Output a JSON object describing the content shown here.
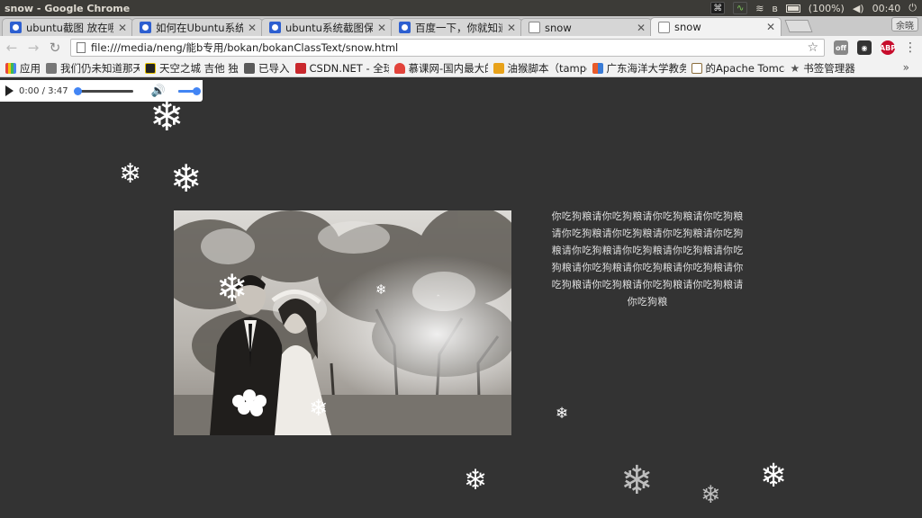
{
  "os": {
    "window_title": "snow - Google Chrome",
    "battery": "(100%)",
    "clock": "00:40"
  },
  "tabs": [
    {
      "label": "ubuntu截图 放在哪",
      "icon": "baidu-paw-icon"
    },
    {
      "label": "如何在Ubuntu系统",
      "icon": "baidu-paw-icon"
    },
    {
      "label": "ubuntu系统截图保",
      "icon": "baidu-paw-icon"
    },
    {
      "label": "百度一下，你就知道",
      "icon": "baidu-paw-icon"
    },
    {
      "label": "snow",
      "icon": "page-icon"
    },
    {
      "label": "snow",
      "icon": "page-icon",
      "active": true
    }
  ],
  "profile_label": "余晓",
  "toolbar": {
    "url": "file:///media/neng/能b专用/bokan/bokanClassText/snow.html"
  },
  "bookmarks": [
    {
      "label": "应用",
      "color": "#e8453c"
    },
    {
      "label": "我们仍未知道那天",
      "color": "#555555"
    },
    {
      "label": "天空之城 吉他 独奏",
      "color": "#222222"
    },
    {
      "label": "已导入",
      "color": "#5a5a5a"
    },
    {
      "label": "CSDN.NET - 全球",
      "color": "#c9282d"
    },
    {
      "label": "慕课网-国内最大的",
      "color": "#e2433b"
    },
    {
      "label": "油猴脚本（tampe",
      "color": "#e8a21a"
    },
    {
      "label": "广东海洋大学教务",
      "color": "#e95b2a"
    },
    {
      "label": "的Apache Tomcat",
      "color": "#8a6d3b"
    },
    {
      "label": "书签管理器",
      "color": "#555555"
    }
  ],
  "audio": {
    "time": "0:00 / 3:47",
    "progress": 0,
    "volume": 1
  },
  "poem": "你吃狗粮请你吃狗粮请你吃狗粮请你吃狗粮请你吃狗粮请你吃狗粮请你吃狗粮请你吃狗粮请你吃狗粮请你吃狗粮请你吃狗粮请你吃狗粮请你吃狗粮请你吃狗粮请你吃狗粮请你吃狗粮请你吃狗粮请你吃狗粮请你吃狗粮请你吃狗粮",
  "colors": {
    "page_bg": "#333333",
    "accent": "#4285f4"
  }
}
